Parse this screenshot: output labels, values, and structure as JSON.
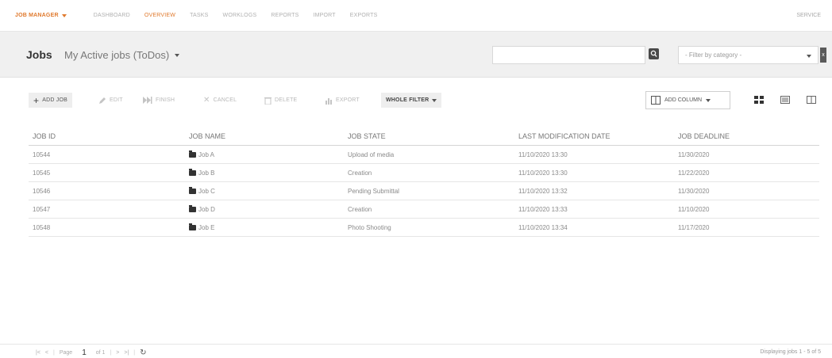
{
  "nav": {
    "brand": "JOB MANAGER",
    "items": [
      "DASHBOARD",
      "OVERVIEW",
      "TASKS",
      "WORKLOGS",
      "REPORTS",
      "IMPORT",
      "EXPORTS"
    ],
    "active": "OVERVIEW",
    "service": "SERVICE",
    "accent_color": "#e07a2e"
  },
  "header": {
    "title": "Jobs",
    "view_selector": "My Active jobs (ToDos)",
    "search_placeholder": "",
    "filter_placeholder": "- Filter by category -",
    "filter_clear": "x"
  },
  "toolbar": {
    "add_job": "ADD JOB",
    "edit": "EDIT",
    "finish": "FINISH",
    "cancel": "CANCEL",
    "delete": "DELETE",
    "export": "EXPORT",
    "whole_filter": "WHOLE FILTER",
    "add_column": "ADD COLUMN"
  },
  "table": {
    "columns": [
      "JOB ID",
      "JOB NAME",
      "JOB STATE",
      "LAST MODIFICATION DATE",
      "JOB DEADLINE"
    ],
    "rows": [
      {
        "id": "10544",
        "name": "Job A",
        "state": "Upload of media",
        "modified": "11/10/2020 13:30",
        "deadline": "11/30/2020"
      },
      {
        "id": "10545",
        "name": "Job B",
        "state": "Creation",
        "modified": "11/10/2020 13:30",
        "deadline": "11/22/2020"
      },
      {
        "id": "10546",
        "name": "Job C",
        "state": "Pending Submittal",
        "modified": "11/10/2020 13:32",
        "deadline": "11/30/2020"
      },
      {
        "id": "10547",
        "name": "Job D",
        "state": "Creation",
        "modified": "11/10/2020 13:33",
        "deadline": "11/10/2020"
      },
      {
        "id": "10548",
        "name": "Job E",
        "state": "Photo Shooting",
        "modified": "11/10/2020 13:34",
        "deadline": "11/17/2020"
      }
    ]
  },
  "footer": {
    "page_label": "Page",
    "page_value": "1",
    "of_label": "of 1",
    "displaying": "Displaying jobs 1 - 5 of 5"
  }
}
